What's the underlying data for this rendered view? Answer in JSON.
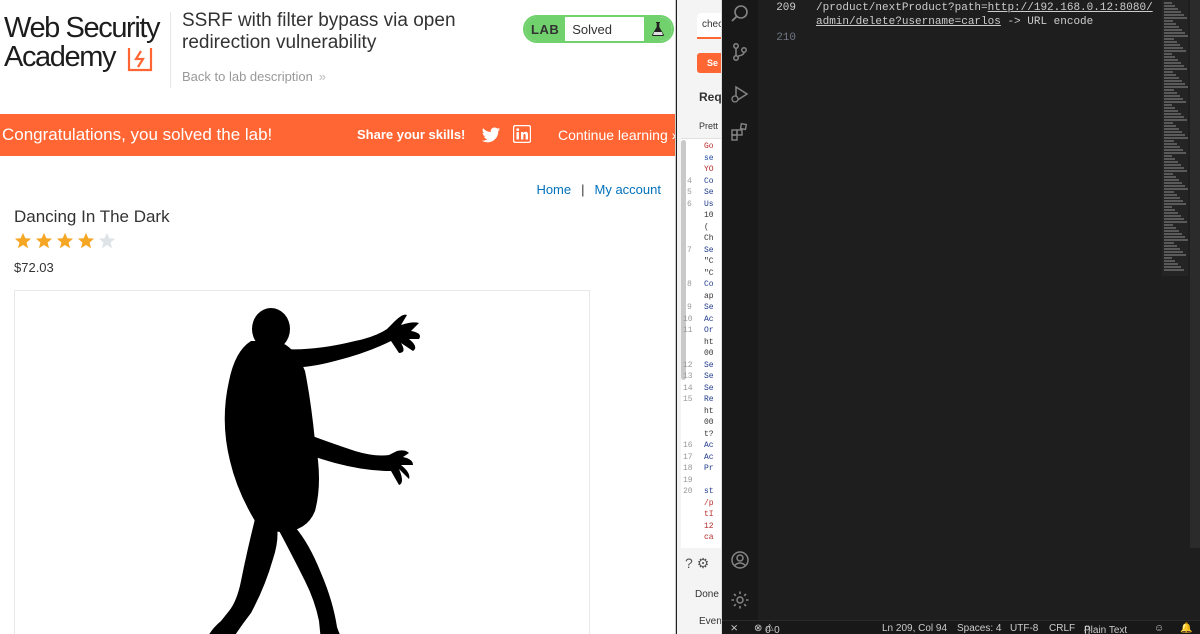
{
  "browser": {
    "logo": {
      "line1": "Web Security",
      "line2": "Academy"
    },
    "lab_title": "SSRF with filter bypass via open redirection vulnerability",
    "back_link": "Back to lab description",
    "lab_badge": {
      "label": "LAB",
      "status": "Solved"
    },
    "banner": {
      "message": "Congratulations, you solved the lab!",
      "share": "Share your skills!",
      "continue": "Continue learning"
    },
    "nav": {
      "home": "Home",
      "separator": "|",
      "account": "My account"
    },
    "product": {
      "name": "Dancing In The Dark",
      "rating": 4,
      "rating_max": 5,
      "price": "$72.03"
    }
  },
  "burp": {
    "tab_label": "chec",
    "send_label": "Se",
    "request_label": "Req",
    "pretty_label": "Prett",
    "lines": [
      {
        "n": "",
        "t": "Go",
        "c": "#b82c2c"
      },
      {
        "n": "",
        "t": "se",
        "c": "#1f4aa6"
      },
      {
        "n": "",
        "t": "YO",
        "c": "#b82c2c"
      },
      {
        "n": "4",
        "t": "Co",
        "c": "#1f3b8a"
      },
      {
        "n": "5",
        "t": "Se",
        "c": "#1f3b8a"
      },
      {
        "n": "6",
        "t": "Us",
        "c": "#1f3b8a"
      },
      {
        "n": "",
        "t": "10",
        "c": "#333"
      },
      {
        "n": "",
        "t": "(",
        "c": "#333"
      },
      {
        "n": "",
        "t": "Ch",
        "c": "#333"
      },
      {
        "n": "7",
        "t": "Se",
        "c": "#1f3b8a"
      },
      {
        "n": "",
        "t": "\"C",
        "c": "#333"
      },
      {
        "n": "",
        "t": "\"C",
        "c": "#333"
      },
      {
        "n": "8",
        "t": "Co",
        "c": "#1f3b8a"
      },
      {
        "n": "",
        "t": "ap",
        "c": "#333"
      },
      {
        "n": "9",
        "t": "Se",
        "c": "#1f3b8a"
      },
      {
        "n": "10",
        "t": "Ac",
        "c": "#1f3b8a"
      },
      {
        "n": "11",
        "t": "Or",
        "c": "#1f3b8a"
      },
      {
        "n": "",
        "t": "ht",
        "c": "#333"
      },
      {
        "n": "",
        "t": "00",
        "c": "#333"
      },
      {
        "n": "12",
        "t": "Se",
        "c": "#1f3b8a"
      },
      {
        "n": "13",
        "t": "Se",
        "c": "#1f3b8a"
      },
      {
        "n": "14",
        "t": "Se",
        "c": "#1f3b8a"
      },
      {
        "n": "15",
        "t": "Re",
        "c": "#1f3b8a"
      },
      {
        "n": "",
        "t": "ht",
        "c": "#333"
      },
      {
        "n": "",
        "t": "00",
        "c": "#333"
      },
      {
        "n": "",
        "t": "t?",
        "c": "#333"
      },
      {
        "n": "16",
        "t": "Ac",
        "c": "#1f3b8a"
      },
      {
        "n": "17",
        "t": "Ac",
        "c": "#1f3b8a"
      },
      {
        "n": "18",
        "t": "Pr",
        "c": "#1f3b8a"
      },
      {
        "n": "19",
        "t": "",
        "c": "#333"
      },
      {
        "n": "20",
        "t": "st",
        "c": "#1f3b8a"
      },
      {
        "n": "",
        "t": "/p",
        "c": "#b82c2c"
      },
      {
        "n": "",
        "t": "tI",
        "c": "#b82c2c"
      },
      {
        "n": "",
        "t": "12",
        "c": "#b82c2c"
      },
      {
        "n": "",
        "t": "ca",
        "c": "#b82c2c"
      }
    ],
    "done_label": "Done",
    "event_label": "Even"
  },
  "vscode": {
    "lines": [
      {
        "num": "209",
        "pre": "/product/nextProduct?path=",
        "url": "http://192.168.0.12:8080/"
      },
      {
        "num": "",
        "url2": "admin/delete?username=carlos",
        "post": " -> URL encode"
      },
      {
        "num": "210"
      }
    ],
    "status": {
      "errors": "0",
      "warnings": "0",
      "position": "Ln 209, Col 94",
      "spaces": "Spaces: 4",
      "encoding": "UTF-8",
      "eol": "CRLF",
      "language": "Plain Text",
      "braces": "{}"
    }
  },
  "colors": {
    "orange": "#ff6633",
    "green": "#70d16d",
    "link": "#0071bc",
    "star": "#f5a623"
  }
}
